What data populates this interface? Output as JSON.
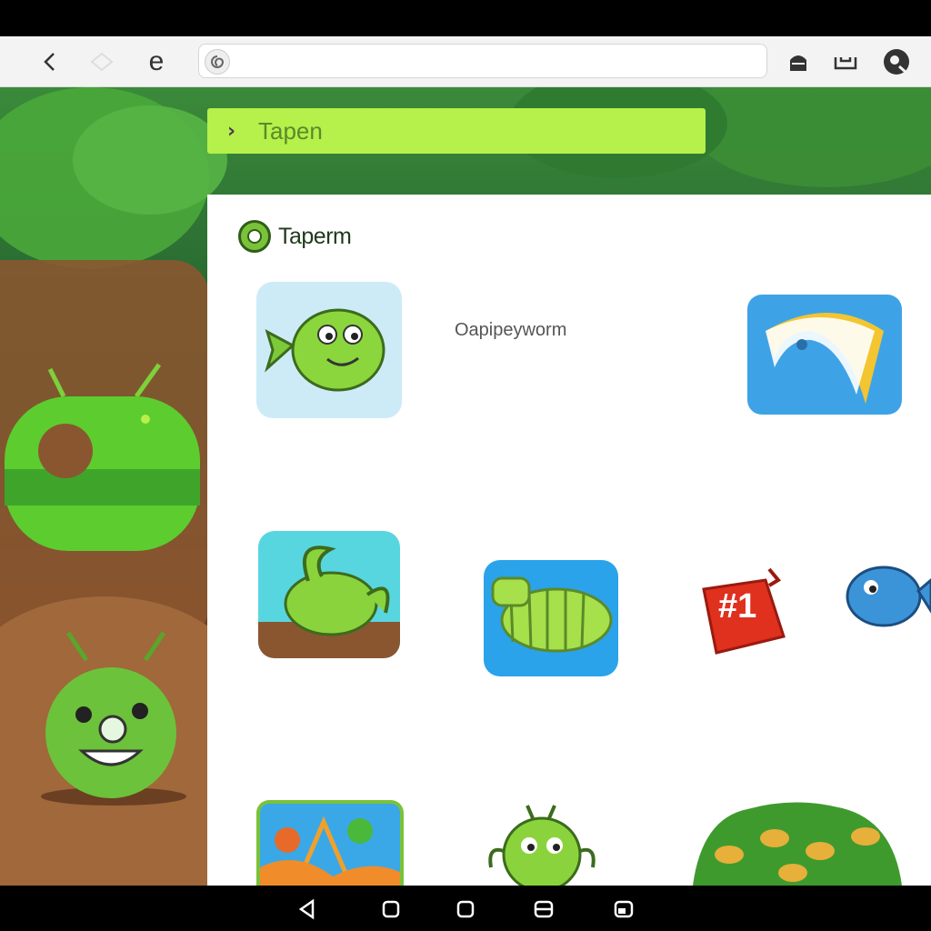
{
  "browser": {
    "url": "",
    "back_icon": "chevron-left-icon",
    "forward_icon": "diamond-icon",
    "edge_icon": "e-icon",
    "site_icon": "swirl-icon",
    "right_icons": [
      "lock-icon",
      "tray-icon",
      "profile-icon"
    ]
  },
  "topbar": {
    "title": "Tapen"
  },
  "panel": {
    "brand": "Taperm",
    "tile_label": "Oapipeyworm"
  },
  "tiles": [
    {
      "name": "worm-fish-tile"
    },
    {
      "name": "blue-swirl-tile"
    },
    {
      "name": "snail-tile"
    },
    {
      "name": "caterpillar-tile"
    },
    {
      "name": "badge-tile",
      "text": "#1"
    },
    {
      "name": "blue-fish-tile"
    },
    {
      "name": "aquarium-tile"
    },
    {
      "name": "bug-tile"
    },
    {
      "name": "leafy-tile"
    }
  ],
  "nav": [
    "back-triangle-icon",
    "home-square-icon",
    "recents-square-icon",
    "menu-icon",
    "window-icon"
  ]
}
